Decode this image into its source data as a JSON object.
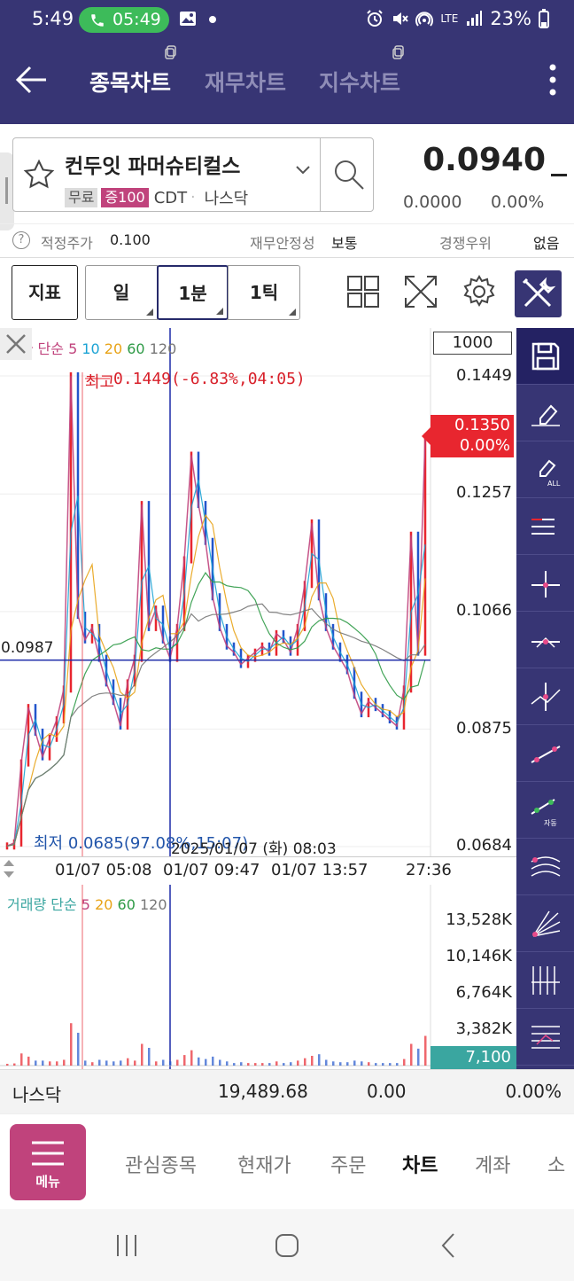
{
  "status_bar": {
    "time": "5:49",
    "call_time": "05:49",
    "battery": "23%",
    "icons": [
      "alarm-icon",
      "mute-icon",
      "hotspot-icon",
      "lte-icon",
      "signal-icon",
      "battery-icon"
    ],
    "lte": "LTE"
  },
  "app_bar": {
    "tabs": [
      {
        "label": "종목차트",
        "active": true
      },
      {
        "label": "재무차트",
        "active": false
      },
      {
        "label": "지수차트",
        "active": false
      }
    ]
  },
  "stock": {
    "name": "컨두잇 파머슈티컬스",
    "badge_free": "무료",
    "badge_margin": "증100",
    "ticker": "CDT",
    "exchange": "나스닥",
    "price": "0.0940",
    "change": "0.0000",
    "change_pct": "0.00%"
  },
  "info_row": {
    "help": "?",
    "fair_price_label": "적정주가",
    "fair_price_value": "0.100",
    "stability_label": "재무안정성",
    "stability_value": "보통",
    "competitive_label": "경쟁우위",
    "competitive_value": "없음"
  },
  "toolbar": {
    "indicator": "지표",
    "period_day": "일",
    "period_1min": "1분",
    "period_1tick": "1틱"
  },
  "chart": {
    "count_box": "1000",
    "price_legend": {
      "title": "종가 단순",
      "ma": [
        {
          "label": "5",
          "color": "#c0437c"
        },
        {
          "label": "10",
          "color": "#1ba3d4"
        },
        {
          "label": "20",
          "color": "#e8a317"
        },
        {
          "label": "60",
          "color": "#2e9a46"
        },
        {
          "label": "120",
          "color": "#777777"
        }
      ]
    },
    "volume_legend": {
      "title": "거래량 단순",
      "ma": [
        {
          "label": "5",
          "color": "#c0437c"
        },
        {
          "label": "20",
          "color": "#e8a317"
        },
        {
          "label": "60",
          "color": "#2e9a46"
        },
        {
          "label": "120",
          "color": "#777777"
        }
      ]
    },
    "high_marker": "최고",
    "high_label": "0.1449(-6.83%,04:05)",
    "low_label": "최저 0.0685(97.08%,15:07)",
    "crosshair_price": "0.0987",
    "crosshair_date": "2025/01/07 (화) 08:03",
    "current_price": "0.1350",
    "current_pct": "0.00%",
    "volume_current": "7,100",
    "colors": {
      "up": "#e8262f",
      "down": "#2255cc",
      "crosshair": "#1c2aa8"
    }
  },
  "chart_data": {
    "type": "line",
    "title": "",
    "y_ticks": [
      "0.1449",
      "0.1257",
      "0.1066",
      "0.0875",
      "0.0684"
    ],
    "ylim": [
      0.0684,
      0.1449
    ],
    "x_ticks": [
      "01/07 05:08",
      "01/07 09:47",
      "01/07 13:57",
      "27:36"
    ],
    "series": [
      {
        "name": "close",
        "values": [
          0.0685,
          0.069,
          0.082,
          0.091,
          0.087,
          0.083,
          0.086,
          0.089,
          0.094,
          0.1449,
          0.106,
          0.102,
          0.104,
          0.099,
          0.095,
          0.092,
          0.088,
          0.095,
          0.099,
          0.124,
          0.104,
          0.107,
          0.102,
          0.099,
          0.104,
          0.115,
          0.132,
          0.124,
          0.118,
          0.109,
          0.104,
          0.101,
          0.1,
          0.098,
          0.099,
          0.1,
          0.101,
          0.1,
          0.103,
          0.102,
          0.1,
          0.104,
          0.111,
          0.121,
          0.109,
          0.104,
          0.101,
          0.099,
          0.097,
          0.093,
          0.09,
          0.092,
          0.091,
          0.09,
          0.089,
          0.088,
          0.094,
          0.119,
          0.1,
          0.135
        ]
      }
    ],
    "volume": {
      "y_ticks": [
        "13,528K",
        "10,146K",
        "6,764K",
        "3,382K"
      ],
      "ylim": [
        0,
        13528
      ]
    }
  },
  "index_bar": {
    "name": "나스닥",
    "value": "19,489.68",
    "change": "0.00",
    "change_pct": "0.00%"
  },
  "bottom_nav": {
    "menu": "메뉴",
    "items": [
      {
        "label": "관심종목",
        "active": false
      },
      {
        "label": "현재가",
        "active": false
      },
      {
        "label": "주문",
        "active": false
      },
      {
        "label": "차트",
        "active": true
      },
      {
        "label": "계좌",
        "active": false
      },
      {
        "label": "소",
        "active": false
      }
    ]
  }
}
